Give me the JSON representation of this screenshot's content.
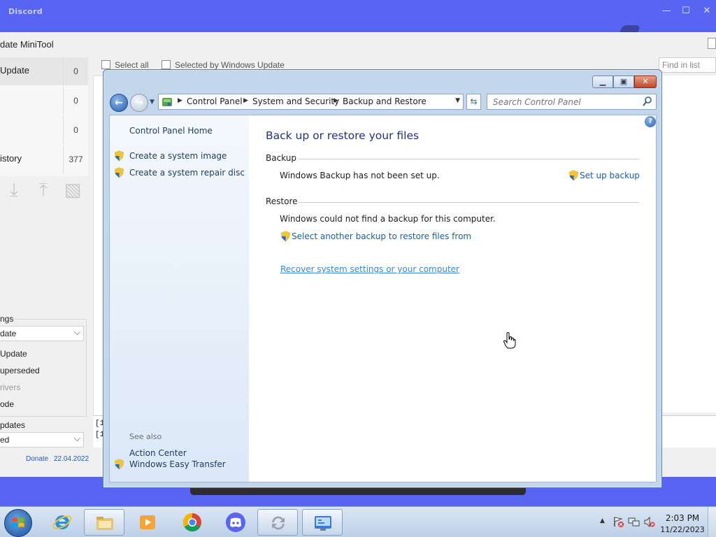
{
  "discord": {
    "title": "Discord",
    "min": "—",
    "max": "☐",
    "close": "✕"
  },
  "minitool": {
    "title": "date MiniTool",
    "left_items": [
      {
        "label": "Update",
        "count": "0"
      },
      {
        "label": "",
        "count": "0"
      },
      {
        "label": "",
        "count": "0"
      },
      {
        "label": "istory",
        "count": "377"
      }
    ],
    "settings_label": "ngs",
    "settings_combo": "date",
    "options": [
      "Update",
      "uperseded",
      "rivers",
      "ode"
    ],
    "updates_label": "pdates",
    "updates_combo": "ed",
    "donate": "Donate",
    "date": "22.04.2022",
    "select_all": "Select all",
    "selected_by_wu": "Selected by Windows Update",
    "find_placeholder": "Find in list",
    "log_lines": [
      "[1",
      "[1"
    ]
  },
  "control_panel": {
    "breadcrumbs": [
      "Control Panel",
      "System and Security",
      "Backup and Restore"
    ],
    "search_placeholder": "Search Control Panel",
    "sidebar": {
      "home": "Control Panel Home",
      "links": [
        "Create a system image",
        "Create a system repair disc"
      ],
      "see_also": "See also",
      "see_also_links": [
        "Action Center",
        "Windows Easy Transfer"
      ]
    },
    "main": {
      "title": "Back up or restore your files",
      "backup_heading": "Backup",
      "backup_status": "Windows Backup has not been set up.",
      "setup_link": "Set up backup",
      "restore_heading": "Restore",
      "restore_status": "Windows could not find a backup for this computer.",
      "select_backup_link": "Select another backup to restore files from",
      "recover_link": "Recover system settings or your computer"
    },
    "help": "?"
  },
  "taskbar": {
    "apps": [
      "internet-explorer",
      "file-explorer",
      "media-player",
      "chrome",
      "discord",
      "sync-tool",
      "control-panel"
    ],
    "time": "2:03 PM",
    "date": "11/22/2023"
  },
  "colors": {
    "discord_blurple": "#5865f2",
    "link_blue": "#1c5ea8",
    "title_blue": "#1e3287"
  }
}
